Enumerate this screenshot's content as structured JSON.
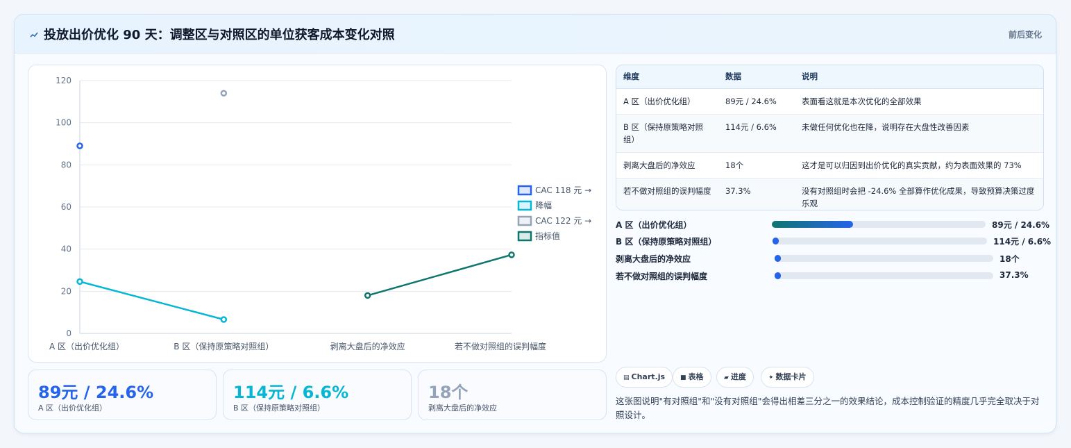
{
  "header": {
    "title": "投放出价优化 90 天：调整区与对照区的单位获客成本变化对照",
    "tag": "前后变化"
  },
  "chart_data": {
    "type": "line",
    "categories": [
      "A 区（出价优化组）",
      "B 区（保持原策略对照组）",
      "剥离大盘后的净效应",
      "若不做对照组的误判幅度"
    ],
    "ylim": [
      0,
      120
    ],
    "yticks": [
      0,
      20,
      40,
      60,
      80,
      100,
      120
    ],
    "grid": true,
    "legend_position": "right",
    "series": [
      {
        "name": "CAC 118 元 →",
        "kind": "point",
        "color": "#2563eb",
        "points": [
          [
            0,
            89
          ]
        ]
      },
      {
        "name": "降幅",
        "kind": "line",
        "color": "#06b6d4",
        "points": [
          [
            0,
            24.6
          ],
          [
            1,
            6.6
          ]
        ]
      },
      {
        "name": "CAC 122 元 →",
        "kind": "point",
        "color": "#94a3b8",
        "points": [
          [
            1,
            114
          ]
        ]
      },
      {
        "name": "指标值",
        "kind": "line",
        "color": "#0f766e",
        "points": [
          [
            2,
            18
          ],
          [
            3,
            37.3
          ]
        ]
      }
    ]
  },
  "kpis": [
    {
      "value": "89元 / 24.6%",
      "label": "A 区（出价优化组）",
      "color": "#2563eb"
    },
    {
      "value": "114元 / 6.6%",
      "label": "B 区（保持原策略对照组）",
      "color": "#06b6d4"
    },
    {
      "value": "18个",
      "label": "剥离大盘后的净效应",
      "color": "#94a3b8"
    }
  ],
  "table": {
    "headers": [
      "维度",
      "数据",
      "说明"
    ],
    "rows": [
      [
        "A 区（出价优化组）",
        "89元 / 24.6%",
        "表面看这就是本次优化的全部效果"
      ],
      [
        "B 区（保持原策略对照组）",
        "114元 / 6.6%",
        "未做任何优化也在降，说明存在大盘性改善因素"
      ],
      [
        "剥离大盘后的净效应",
        "18个",
        "这才是可以归因到出价优化的真实贡献，约为表面效果的 73%"
      ],
      [
        "若不做对照组的误判幅度",
        "37.3%",
        "没有对照组时会把 -24.6% 全部算作优化成果，导致预算决策过度乐观"
      ]
    ]
  },
  "bars": [
    {
      "label": "A 区（出价优化组）",
      "value": "89元 / 24.6%",
      "fraction": 0.38
    },
    {
      "label": "B 区（保持原策略对照组）",
      "value": "114元 / 6.6%",
      "fraction": 0.02
    },
    {
      "label": "剥离大盘后的净效应",
      "value": "18个",
      "fraction": 0.02
    },
    {
      "label": "若不做对照组的误判幅度",
      "value": "37.3%",
      "fraction": 0.02
    }
  ],
  "chips": [
    {
      "icon": "chart-icon",
      "label": "Chart.js"
    },
    {
      "icon": "table-icon",
      "label": "表格"
    },
    {
      "icon": "progress-icon",
      "label": "进度"
    },
    {
      "icon": "card-icon",
      "label": "数据卡片"
    }
  ],
  "note": "这张图说明\"有对照组\"和\"没有对照组\"会得出相差三分之一的效果结论，成本控制验证的精度几乎完全取决于对照设计。"
}
